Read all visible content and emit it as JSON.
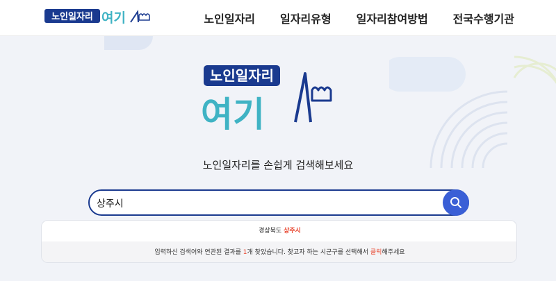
{
  "header": {
    "logo_text_1": "노인일자리",
    "logo_text_2": "여기",
    "nav": [
      "노인일자리",
      "일자리유형",
      "일자리참여방법",
      "전국수행기관"
    ]
  },
  "hero": {
    "logo_text_1": "노인일자리",
    "logo_text_2": "여기",
    "tagline": "노인일자리를 손쉽게 검색해보세요"
  },
  "search": {
    "value": "상주시",
    "button_icon": "search-icon"
  },
  "results": {
    "province": "경상북도",
    "city": "상주시",
    "info_before": "입력하신 검색어와 연관된 결과를 ",
    "count": "1",
    "info_middle": "개 찾았습니다. 찾고자 하는 시군구를 선택해서 ",
    "click_word": "클릭",
    "info_after": "해주세요"
  },
  "colors": {
    "brand_navy": "#1a3a8f",
    "brand_teal": "#3fb3c4",
    "search_button": "#3a5fd6",
    "highlight_red": "#e8462f",
    "hero_bg": "#f1f3f8"
  }
}
